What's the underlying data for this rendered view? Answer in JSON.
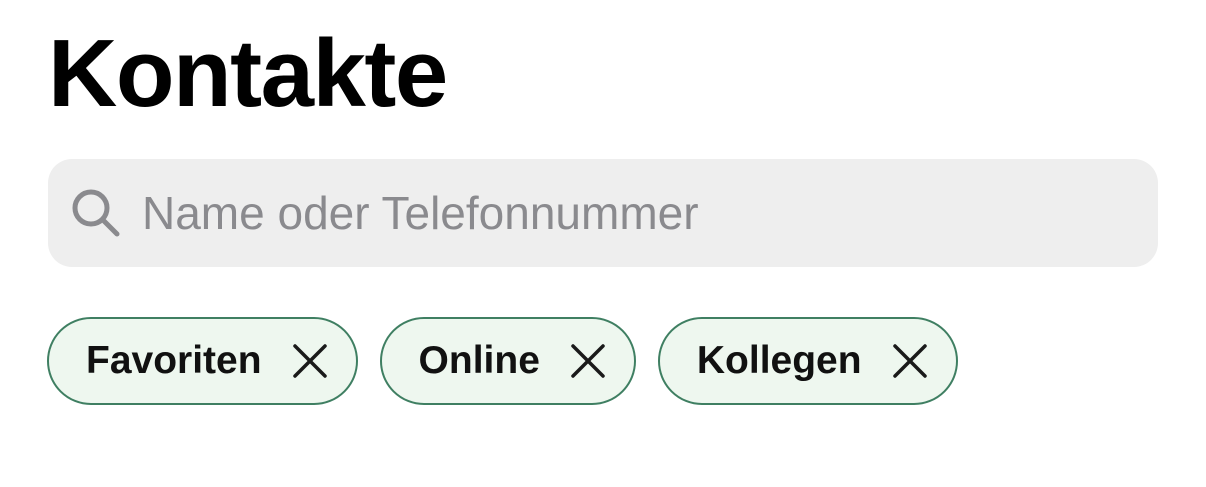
{
  "header": {
    "title": "Kontakte"
  },
  "search": {
    "placeholder": "Name oder Telefonnummer",
    "value": "",
    "icon": "search-icon"
  },
  "filters": {
    "chips": [
      {
        "label": "Favoriten",
        "icon": "close-icon"
      },
      {
        "label": "Online",
        "icon": "close-icon"
      },
      {
        "label": "Kollegen",
        "icon": "close-icon"
      }
    ]
  },
  "colors": {
    "chip_border": "#3f7f62",
    "chip_background": "#eef7ef",
    "search_background": "#eeeeee",
    "placeholder": "#8a8a8e"
  }
}
